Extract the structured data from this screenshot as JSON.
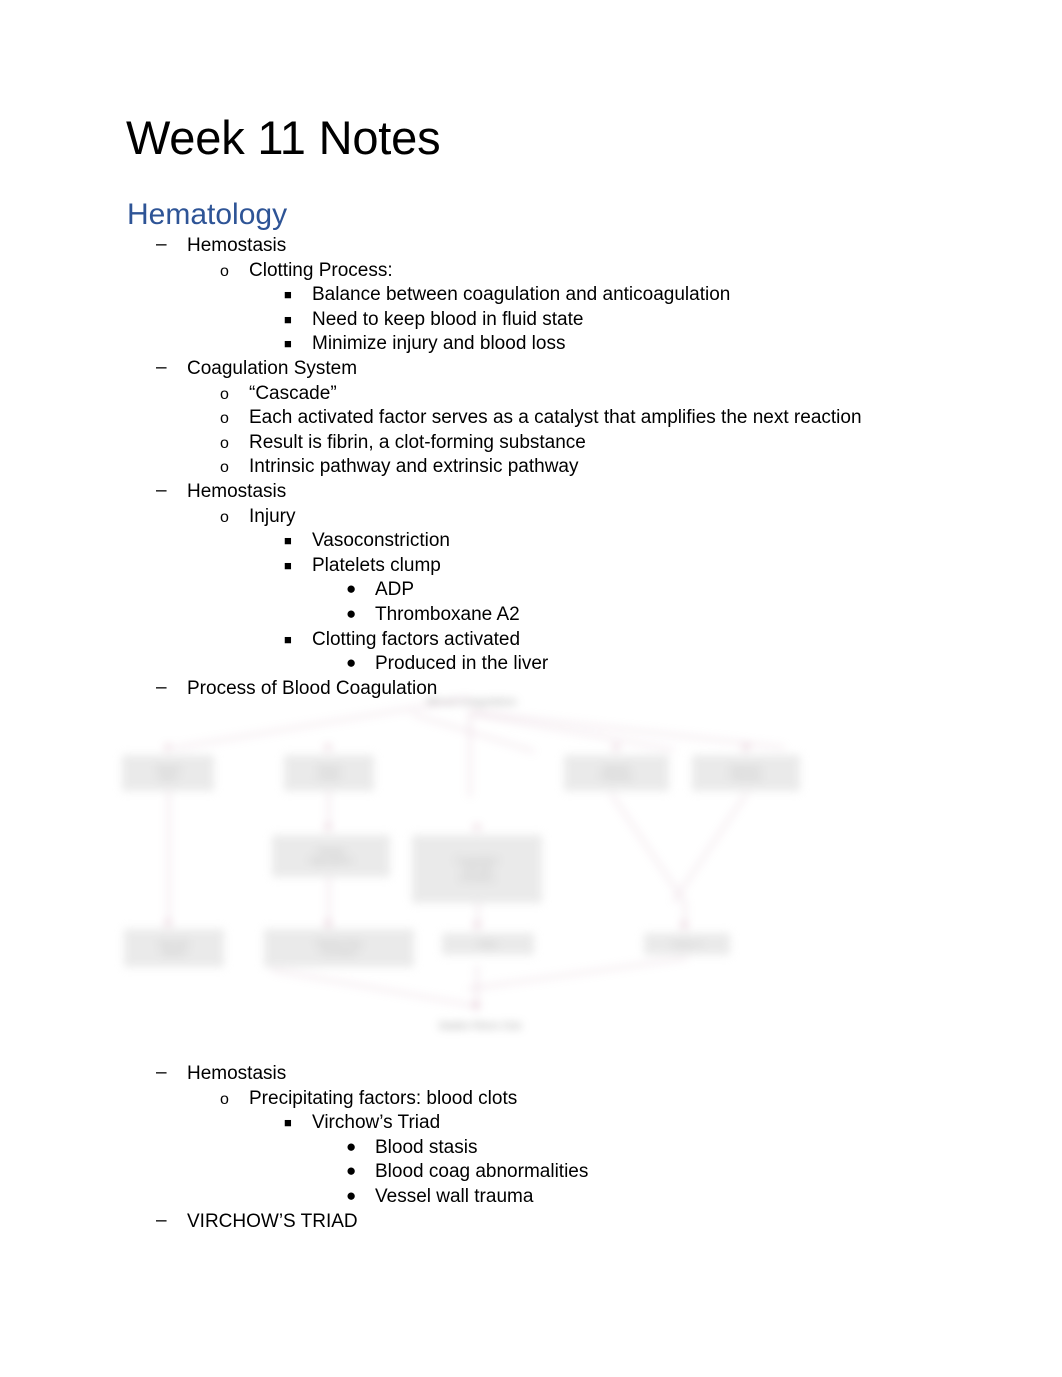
{
  "document": {
    "title": "Week 11 Notes",
    "heading": "Hematology",
    "heading_color": "#2E5496",
    "page_background": "#ffffff",
    "text_color": "#000000"
  },
  "markers": {
    "level1": "–",
    "level2": "o",
    "level3": "■",
    "level4": "●"
  },
  "outline": [
    {
      "level": 1,
      "text": "Hemostasis"
    },
    {
      "level": 2,
      "text": "Clotting Process:"
    },
    {
      "level": 3,
      "text": "Balance between coagulation and anticoagulation"
    },
    {
      "level": 3,
      "text": "Need to keep blood in fluid state"
    },
    {
      "level": 3,
      "text": "Minimize injury and blood loss"
    },
    {
      "level": 1,
      "text": "Coagulation System"
    },
    {
      "level": 2,
      "text": "“Cascade”"
    },
    {
      "level": 2,
      "text": "Each activated factor serves as a catalyst that amplifies the next reaction"
    },
    {
      "level": 2,
      "text": "Result is fibrin, a clot-forming substance"
    },
    {
      "level": 2,
      "text": "Intrinsic pathway and extrinsic pathway"
    },
    {
      "level": 1,
      "text": "Hemostasis"
    },
    {
      "level": 2,
      "text": "Injury"
    },
    {
      "level": 3,
      "text": "Vasoconstriction"
    },
    {
      "level": 3,
      "text": "Platelets clump"
    },
    {
      "level": 4,
      "text": "ADP"
    },
    {
      "level": 4,
      "text": "Thromboxane A2"
    },
    {
      "level": 3,
      "text": "Clotting factors activated"
    },
    {
      "level": 4,
      "text": "Produced in the liver"
    },
    {
      "level": 1,
      "text": "Process of Blood Coagulation"
    }
  ],
  "outline_after_figure": [
    {
      "level": 1,
      "text": "Hemostasis"
    },
    {
      "level": 2,
      "text": "Precipitating factors: blood clots"
    },
    {
      "level": 3,
      "text": "Virchow’s Triad"
    },
    {
      "level": 4,
      "text": "Blood stasis"
    },
    {
      "level": 4,
      "text": "Blood coag abnormalities"
    },
    {
      "level": 4,
      "text": "Vessel wall trauma"
    },
    {
      "level": 1,
      "text": "VIRCHOW’S TRIAD"
    }
  ],
  "figure": {
    "name": "process-of-blood-coagulation-flowchart",
    "appearance": "blurred",
    "node_fill": "#d9d9d9",
    "connector_color": "#cfa8bc",
    "nodes": {
      "n_top": "",
      "n_l1": "",
      "n_l2": "",
      "n_r1": "",
      "n_r2": "",
      "n_mid_l": "",
      "n_center": "",
      "n_b1": "",
      "n_b2": "",
      "n_b3": "",
      "n_b4": "",
      "n_bottom": ""
    }
  }
}
